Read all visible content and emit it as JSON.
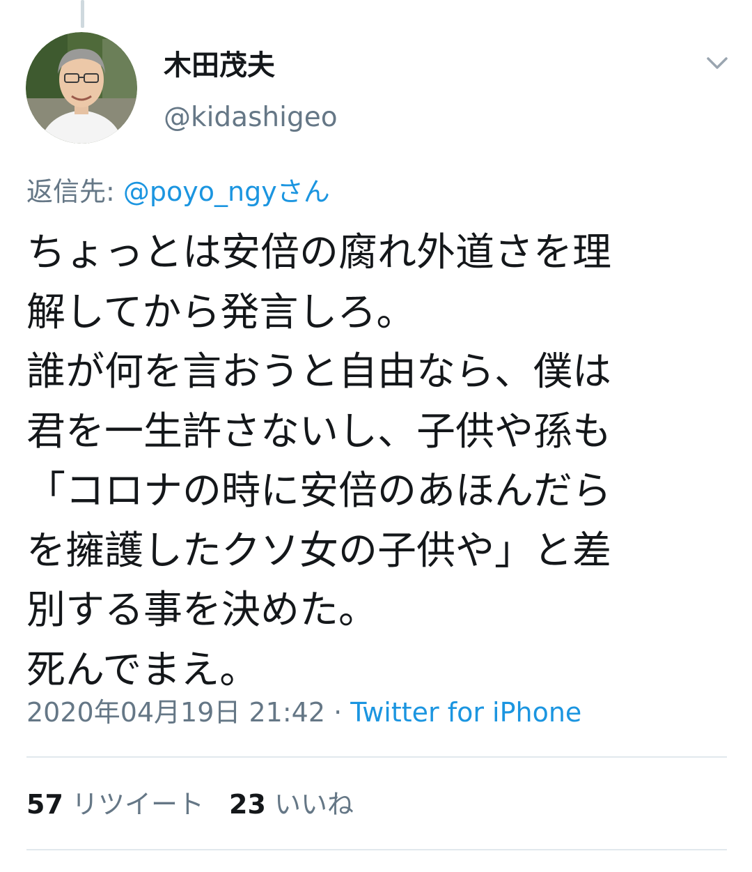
{
  "tweet": {
    "author": {
      "display_name": "木田茂夫",
      "handle": "@kidashigeo"
    },
    "reply_to": {
      "prefix": "返信先: ",
      "mention": "@poyo_ngyさん"
    },
    "body_lines": [
      "ちょっとは安倍の腐れ外道さを理",
      "解してから発言しろ。",
      "誰が何を言おうと自由なら、僕は",
      "君を一生許さないし、子供や孫も",
      "「コロナの時に安倍のあほんだら",
      "を擁護したクソ女の子供や」と差",
      "別する事を決めた。",
      "死んでまえ。"
    ],
    "timestamp": "2020年04月19日 21:42",
    "separator": " · ",
    "source": "Twitter for iPhone",
    "stats": {
      "retweets_count": "57",
      "retweets_label": "リツイート",
      "likes_count": "23",
      "likes_label": "いいね"
    }
  },
  "icons": {
    "menu": "chevron-down-icon",
    "avatar": "avatar"
  },
  "colors": {
    "text_primary": "#14171a",
    "text_secondary": "#657786",
    "link": "#1b95e0",
    "divider": "#e1e8ed"
  }
}
